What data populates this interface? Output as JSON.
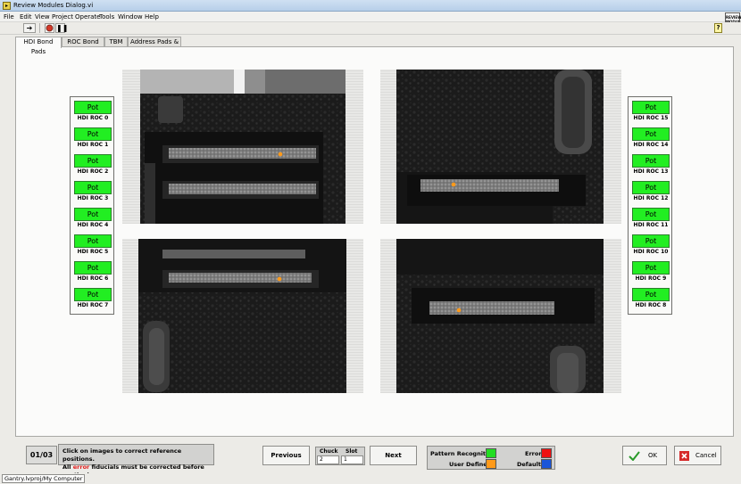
{
  "window": {
    "title": "Review Modules Dialog.vi"
  },
  "menu": [
    "File",
    "Edit",
    "View",
    "Project",
    "Operate",
    "Tools",
    "Window",
    "Help"
  ],
  "logo_text": "REVIEW MODULES DIALOG",
  "tabs": [
    "HDI Bond Pads",
    "ROC Bond Pads",
    "TBM",
    "Address Pads & HV"
  ],
  "pot_label": "Pot",
  "left_rocs": [
    "HDI ROC 0",
    "HDI ROC 1",
    "HDI ROC 2",
    "HDI ROC 3",
    "HDI ROC 4",
    "HDI ROC 5",
    "HDI ROC 6",
    "HDI ROC 7"
  ],
  "right_rocs": [
    "HDI ROC 15",
    "HDI ROC 14",
    "HDI ROC 13",
    "HDI ROC 12",
    "HDI ROC 11",
    "HDI ROC 10",
    "HDI ROC 9",
    "HDI ROC 8"
  ],
  "bottom": {
    "page": "01/03",
    "message_line1": "Click on images to correct reference positions.",
    "message_line2_prefix": "All",
    "message_line2_error": "error",
    "message_line2_suffix": "fiducials must be corrected before continuing.",
    "previous_label": "Previous",
    "next_label": "Next",
    "chuck_label": "Chuck",
    "chuck_value": "2",
    "slot_label": "Slot",
    "slot_value": "1",
    "ok_label": "OK",
    "cancel_label": "Cancel"
  },
  "legend": {
    "pattern_recognition": "Pattern Recognition",
    "user_defined": "User Defined",
    "error": "Error",
    "default": "Default"
  },
  "colors": {
    "pattern_recognition": "#22dd22",
    "user_defined": "#ff9a1a",
    "error": "#ee1111",
    "default": "#1a55d8",
    "pot_button": "#22ee22"
  },
  "status_path": "Gantry.lvproj/My Computer"
}
